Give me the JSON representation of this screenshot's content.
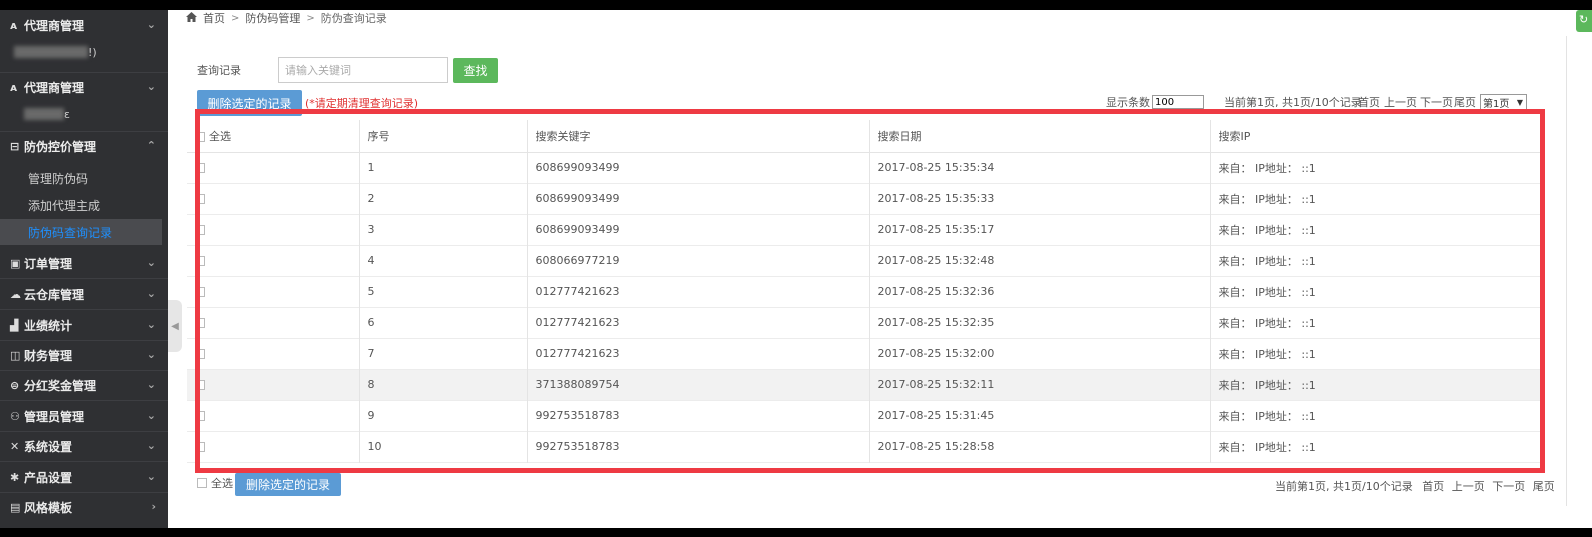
{
  "sidebar": {
    "items": [
      {
        "icon": "person-icon",
        "glyph": "ᴀ",
        "label": "代理商管理",
        "chevron": "⌄"
      },
      {
        "icon": "person-icon",
        "glyph": "ᴀ",
        "label": "代理商管理",
        "chevron": "⌄"
      },
      {
        "icon": "barcode-icon",
        "glyph": "⊟",
        "label": "防伪控价管理",
        "chevron": "⌃"
      },
      {
        "icon": "order-icon",
        "glyph": "▣",
        "label": "订单管理",
        "chevron": "⌄"
      },
      {
        "icon": "cloud-icon",
        "glyph": "☁",
        "label": "云仓库管理",
        "chevron": "⌄"
      },
      {
        "icon": "bar-chart-icon",
        "glyph": "▟",
        "label": "业绩统计",
        "chevron": "⌄"
      },
      {
        "icon": "finance-icon",
        "glyph": "◫",
        "label": "财务管理",
        "chevron": "⌄"
      },
      {
        "icon": "bonus-icon",
        "glyph": "⊜",
        "label": "分红奖金管理",
        "chevron": "⌄"
      },
      {
        "icon": "admin-icon",
        "glyph": "⚇",
        "label": "管理员管理",
        "chevron": "⌄"
      },
      {
        "icon": "wrench-icon",
        "glyph": "✕",
        "label": "系统设置",
        "chevron": "⌄"
      },
      {
        "icon": "gear-icon",
        "glyph": "✱",
        "label": "产品设置",
        "chevron": "⌄"
      },
      {
        "icon": "template-icon",
        "glyph": "▤",
        "label": "风格模板",
        "chevron": "›"
      }
    ],
    "blur_suffix_1": "!)",
    "blur_suffix_2": "ɛ",
    "sub_items": [
      {
        "label": "管理防伪码"
      },
      {
        "label": "添加代理主成"
      },
      {
        "label": "防伪码查询记录"
      }
    ]
  },
  "breadcrumb": {
    "home_icon": "home-icon",
    "items": [
      "首页",
      "防伪码管理",
      "防伪查询记录"
    ],
    "separator": ">"
  },
  "search": {
    "label": "查询记录",
    "placeholder": "请输入关键词",
    "value": "",
    "button": "查找"
  },
  "toolbar": {
    "delete_button": "删除选定的记录",
    "warning": "(*请定期清理查询记录)",
    "page_size_label": "显示条数",
    "page_size_value": "100",
    "page_info": "当前第1页, 共1页/10个记录",
    "first": "首页",
    "prev": "上一页",
    "next": "下一页",
    "last": "尾页",
    "page_select": "第1页",
    "page_select_arrow": "▼"
  },
  "table": {
    "headers": [
      "全选",
      "序号",
      "搜索关键字",
      "搜索日期",
      "搜索IP"
    ],
    "rows": [
      {
        "no": "1",
        "keyword": "608699093499",
        "date": "2017-08-25 15:35:34",
        "ip": "来自：  IP地址：  ::1"
      },
      {
        "no": "2",
        "keyword": "608699093499",
        "date": "2017-08-25 15:35:33",
        "ip": "来自：  IP地址：  ::1"
      },
      {
        "no": "3",
        "keyword": "608699093499",
        "date": "2017-08-25 15:35:17",
        "ip": "来自：  IP地址：  ::1"
      },
      {
        "no": "4",
        "keyword": "608066977219",
        "date": "2017-08-25 15:32:48",
        "ip": "来自：  IP地址：  ::1"
      },
      {
        "no": "5",
        "keyword": "012777421623",
        "date": "2017-08-25 15:32:36",
        "ip": "来自：  IP地址：  ::1"
      },
      {
        "no": "6",
        "keyword": "012777421623",
        "date": "2017-08-25 15:32:35",
        "ip": "来自：  IP地址：  ::1"
      },
      {
        "no": "7",
        "keyword": "012777421623",
        "date": "2017-08-25 15:32:00",
        "ip": "来自：  IP地址：  ::1"
      },
      {
        "no": "8",
        "keyword": "371388089754",
        "date": "2017-08-25 15:32:11",
        "ip": "来自：  IP地址：  ::1"
      },
      {
        "no": "9",
        "keyword": "992753518783",
        "date": "2017-08-25 15:31:45",
        "ip": "来自：  IP地址：  ::1"
      },
      {
        "no": "10",
        "keyword": "992753518783",
        "date": "2017-08-25 15:28:58",
        "ip": "来自：  IP地址：  ::1"
      }
    ]
  },
  "bottom": {
    "select_all": "全选",
    "delete_button": "删除选定的记录",
    "page_info": "当前第1页, 共1页/10个记录",
    "first": "首页",
    "prev": "上一页",
    "next": "下一页",
    "last": "尾页"
  },
  "colors": {
    "sidebar_bg": "#2f3033",
    "active_link": "#1e90ff",
    "search_button": "#5cb85c",
    "delete_button": "#5b9bd5",
    "warning_text": "#e03030",
    "highlight_box": "#ee3a43"
  }
}
